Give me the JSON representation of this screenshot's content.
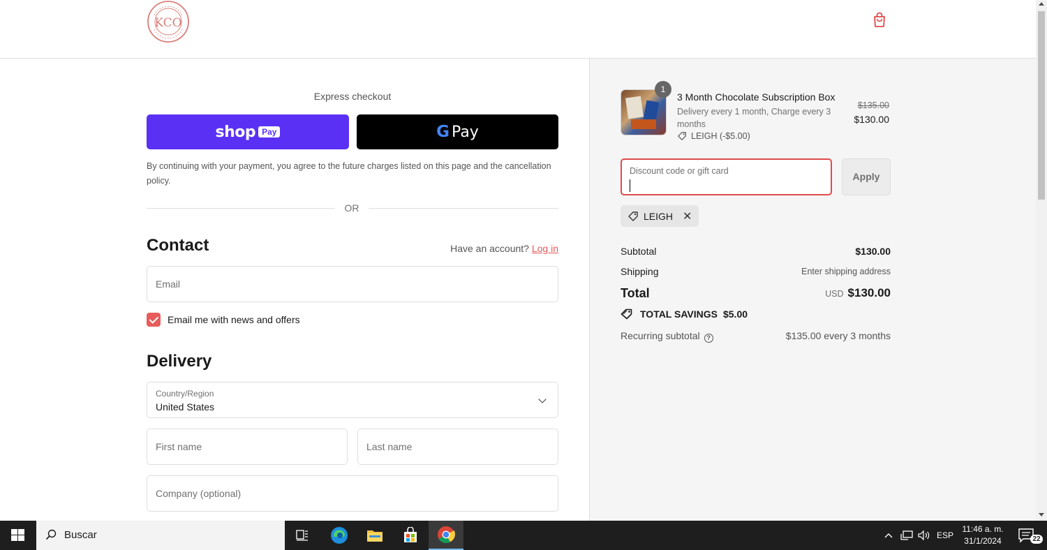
{
  "header": {
    "logo_text": "KCO CHOCOLATE PURVEYORS",
    "logo_initials": "KCO"
  },
  "express": {
    "label": "Express checkout",
    "shoppay_text": "shop",
    "shoppay_badge": "Pay",
    "gpay_letter": "G",
    "gpay_text": "Pay",
    "terms": "By continuing with your payment, you agree to the future charges listed on this page and the cancellation policy.",
    "or_text": "OR"
  },
  "contact": {
    "heading": "Contact",
    "have_account": "Have an account?",
    "login_label": "Log in",
    "email_placeholder": "Email",
    "newsletter_label": "Email me with news and offers",
    "newsletter_checked": true
  },
  "delivery": {
    "heading": "Delivery",
    "country_label": "Country/Region",
    "country_value": "United States",
    "first_name_placeholder": "First name",
    "last_name_placeholder": "Last name",
    "company_placeholder": "Company (optional)"
  },
  "order": {
    "item": {
      "quantity": "1",
      "title": "3 Month Chocolate Subscription Box",
      "subtitle": "Delivery every 1 month, Charge every 3 months",
      "discount_tag": "LEIGH (-$5.00)",
      "price_original": "$135.00",
      "price_current": "$130.00"
    },
    "discount_placeholder": "Discount code or gift card",
    "apply_label": "Apply",
    "applied_code": "LEIGH",
    "subtotal_label": "Subtotal",
    "subtotal_value": "$130.00",
    "shipping_label": "Shipping",
    "shipping_value": "Enter shipping address",
    "total_label": "Total",
    "total_currency": "USD",
    "total_value": "$130.00",
    "savings_label": "TOTAL SAVINGS",
    "savings_value": "$5.00",
    "recurring_label": "Recurring subtotal",
    "recurring_value": "$135.00 every 3 months"
  },
  "taskbar": {
    "search_text": "Buscar",
    "language": "ESP",
    "time": "11:46 a. m.",
    "date": "31/1/2024",
    "notification_count": "22"
  },
  "colors": {
    "shoppay": "#5a31f4",
    "accent": "#e85c5c",
    "error_border": "#e04a4a"
  }
}
